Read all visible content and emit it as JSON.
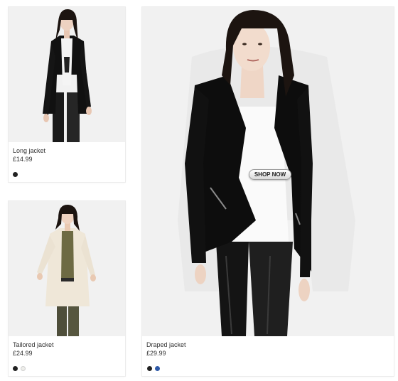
{
  "products": [
    {
      "name": "Long jacket",
      "price": "£14.99",
      "colors": [
        "#222222"
      ]
    },
    {
      "name": "Tailored jacket",
      "price": "£24.99",
      "colors": [
        "#222222",
        "#eeeeea"
      ]
    },
    {
      "name": "Draped jacket",
      "price": "£29.99",
      "colors": [
        "#222222",
        "#2f5aa8"
      ],
      "cta": "SHOP NOW"
    }
  ]
}
